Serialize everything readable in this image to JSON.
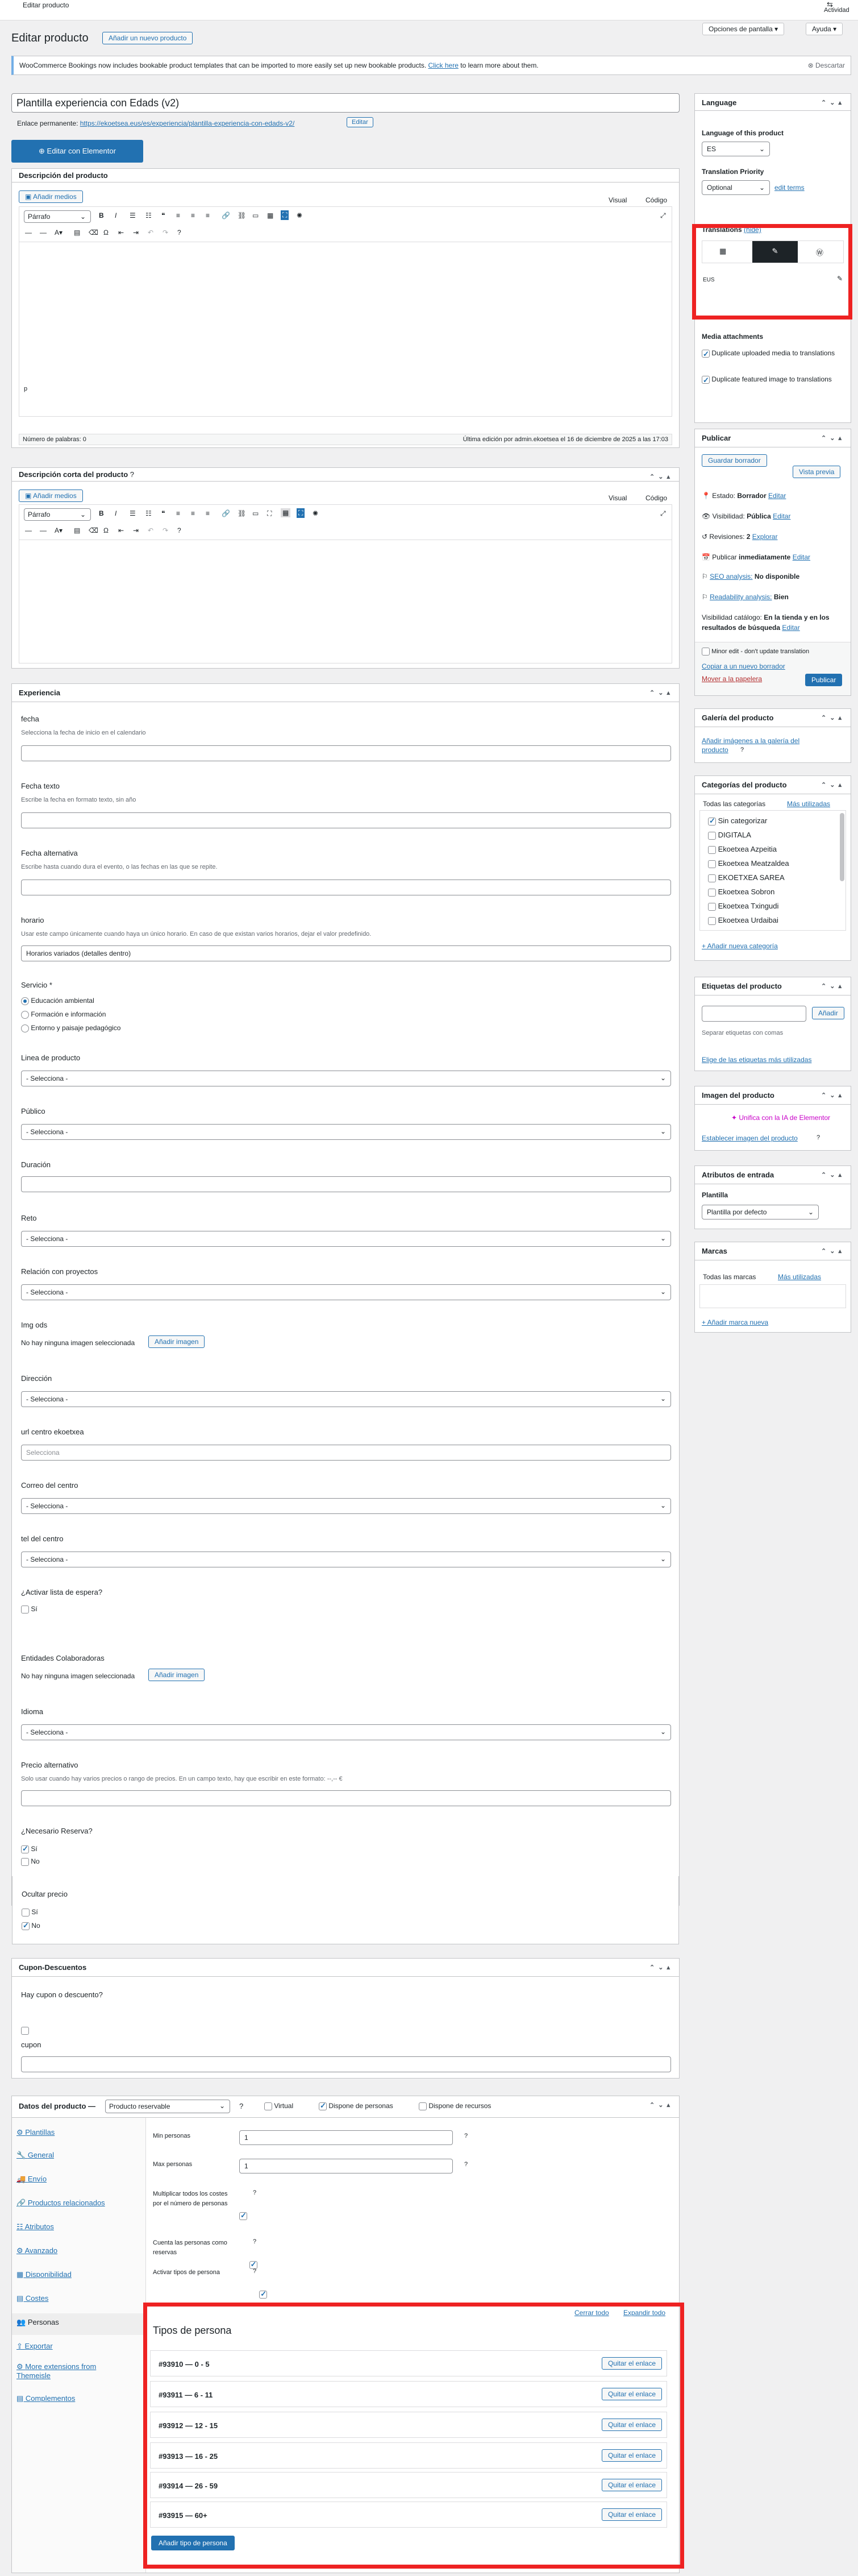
{
  "topbar": {
    "title": "Editar producto",
    "activity": "Actividad"
  },
  "header": {
    "title": "Editar producto",
    "add_new": "Añadir un nuevo producto",
    "screen_options": "Opciones de pantalla",
    "help": "Ayuda"
  },
  "notice": {
    "text": "WooCommerce Bookings now includes bookable product templates that can be imported to more easily set up new bookable products.",
    "link": "Click here",
    "after": "to learn more about them.",
    "dismiss": "Descartar"
  },
  "product": {
    "title": "Plantilla experiencia con Edads (v2)",
    "permalink_label": "Enlace permanente:",
    "permalink_url": "https://ekoetsea.eus/es/experiencia/plantilla-experiencia-con-edads-v2/",
    "permalink_edit": "Editar",
    "elementor": "Editar con Elementor"
  },
  "description": {
    "title": "Descripción del producto",
    "add_media": "Añadir medios",
    "visual": "Visual",
    "code": "Código",
    "format": "Párrafo",
    "path": "p",
    "word_count": "Número de palabras: 0",
    "last_edit": "Última edición por admin.ekoetsea el 16 de diciembre de 2025 a las 17:03"
  },
  "short_description": {
    "title": "Descripción corta del producto",
    "add_media": "Añadir medios",
    "visual": "Visual",
    "code": "Código",
    "format": "Párrafo"
  },
  "experiencia": {
    "title": "Experiencia",
    "fecha": "fecha",
    "fecha_desc": "Selecciona la fecha de inicio en el calendario",
    "fecha_texto": "Fecha texto",
    "fecha_texto_desc": "Escribe la fecha en formato texto, sin año",
    "fecha_alt": "Fecha alternativa",
    "fecha_alt_desc": "Escribe hasta cuando dura el evento, o las fechas en las que se repite.",
    "horario": "horario",
    "horario_desc": "Usar este campo únicamente cuando haya un único horario. En caso de que existan varios horarios, dejar el valor predefinido.",
    "horario_value": "Horarios variados (detalles dentro)",
    "servicio": "Servicio *",
    "servicio_options": [
      "Educación ambiental",
      "Formación e información",
      "Entorno y paisaje pedagógico"
    ],
    "linea": "Linea de producto",
    "publico": "Público",
    "duracion": "Duración",
    "reto": "Reto",
    "relacion": "Relación con proyectos",
    "select_placeholder": "- Selecciona -",
    "img_ods": "Img ods",
    "no_image": "No hay ninguna imagen seleccionada",
    "add_image": "Añadir imagen",
    "direccion": "Dirección",
    "url_centro": "url centro ekoetxea",
    "url_placeholder": "Selecciona",
    "correo": "Correo del centro",
    "tel": "tel del centro",
    "lista_espera": "¿Activar lista de espera?",
    "si": "Sí",
    "no": "No",
    "entidades": "Entidades Colaboradoras",
    "idioma": "Idioma",
    "precio_alt": "Precio alternativo",
    "precio_alt_desc": "Solo usar cuando hay varios precios o rango de precios. En un campo texto, hay que escribir en este formato: --,-- €",
    "reserva": "¿Necesario Reserva?",
    "ocultar_precio": "Ocultar precio"
  },
  "cupon": {
    "title": "Cupon-Descuentos",
    "hay": "Hay cupon o descuento?",
    "cupon": "cupon"
  },
  "datos": {
    "title": "Datos del producto —",
    "type": "Producto reservable",
    "virtual": "Virtual",
    "personas": "Dispone de personas",
    "recursos": "Dispone de recursos",
    "nav": [
      "Plantillas",
      "General",
      "Envío",
      "Productos relacionados",
      "Atributos",
      "Avanzado",
      "Disponibilidad",
      "Costes",
      "Personas",
      "Exportar",
      "More extensions from Themeisle",
      "Complementos"
    ],
    "min_label": "Min personas",
    "min_value": "1",
    "max_label": "Max personas",
    "max_value": "1",
    "mult_label": "Multiplicar todos los costes por el número de personas",
    "cuenta_label": "Cuenta las personas como reservas",
    "activar_label": "Activar tipos de persona",
    "cerrar": "Cerrar todo",
    "expandir": "Expandir todo",
    "tipos_title": "Tipos de persona",
    "tipos": [
      "#93910 — 0 - 5",
      "#93911 — 6 - 11",
      "#93912 — 12 - 15",
      "#93913 — 16 - 25",
      "#93914 — 26 - 59",
      "#93915 — 60+"
    ],
    "quitar": "Quitar el enlace",
    "add_tipo": "Añadir tipo de persona"
  },
  "language": {
    "title": "Language",
    "of_product": "Language of this product",
    "lang": "ES",
    "priority": "Translation Priority",
    "optional": "Optional",
    "edit_terms": "edit terms",
    "translations": "Translations",
    "hide": "(hide)",
    "eus": "EUS",
    "media": "Media attachments",
    "dup_media": "Duplicate uploaded media to translations",
    "dup_featured": "Duplicate featured image to translations"
  },
  "publish": {
    "title": "Publicar",
    "save_draft": "Guardar borrador",
    "preview": "Vista previa",
    "estado": "Estado:",
    "estado_val": "Borrador",
    "visibilidad": "Visibilidad:",
    "visibilidad_val": "Pública",
    "revisiones": "Revisiones:",
    "revisiones_val": "2",
    "explorar": "Explorar",
    "publicar_label": "Publicar",
    "inmediatamente": "inmediatamente",
    "editar": "Editar",
    "seo": "SEO analysis:",
    "seo_val": "No disponible",
    "read": "Readability analysis:",
    "read_val": "Bien",
    "catalogo": "Visibilidad catálogo:",
    "catalogo_val": "En la tienda y en los resultados de búsqueda",
    "minor": "Minor edit - don't update translation",
    "copiar": "Copiar a un nuevo borrador",
    "papelera": "Mover a la papelera",
    "publish_btn": "Publicar"
  },
  "galeria": {
    "title": "Galería del producto",
    "link": "Añadir imágenes a la galería del producto"
  },
  "categorias": {
    "title": "Categorías del producto",
    "tab_all": "Todas las categorías",
    "tab_used": "Más utilizadas",
    "items": [
      "Sin categorizar",
      "DIGITALA",
      "Ekoetxea Azpeitia",
      "Ekoetxea Meatzaldea",
      "EKOETXEA SAREA",
      "Ekoetxea Sobron",
      "Ekoetxea Txingudi",
      "Ekoetxea Urdaibai"
    ],
    "add": "+ Añadir nueva categoría"
  },
  "etiquetas": {
    "title": "Etiquetas del producto",
    "add": "Añadir",
    "desc": "Separar etiquetas con comas",
    "link": "Elige de las etiquetas más utilizadas"
  },
  "imagen": {
    "title": "Imagen del producto",
    "ai": "Unifica con la IA de Elementor",
    "link": "Establecer imagen del producto"
  },
  "atributos": {
    "title": "Atributos de entrada",
    "plantilla": "Plantilla",
    "value": "Plantilla por defecto"
  },
  "marcas": {
    "title": "Marcas",
    "tab_all": "Todas las marcas",
    "tab_used": "Más utilizadas",
    "add": "+ Añadir marca nueva"
  }
}
